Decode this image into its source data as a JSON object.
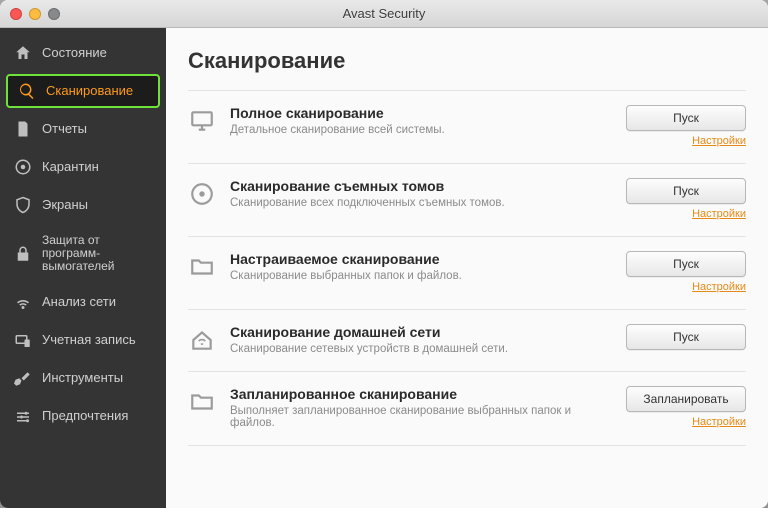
{
  "window": {
    "title": "Avast Security"
  },
  "sidebar": {
    "items": [
      {
        "label": "Состояние"
      },
      {
        "label": "Сканирование"
      },
      {
        "label": "Отчеты"
      },
      {
        "label": "Карантин"
      },
      {
        "label": "Экраны"
      },
      {
        "label": "Защита от программ-вымогателей"
      },
      {
        "label": "Анализ сети"
      },
      {
        "label": "Учетная запись"
      },
      {
        "label": "Инструменты"
      },
      {
        "label": "Предпочтения"
      }
    ]
  },
  "main": {
    "heading": "Сканирование",
    "settings_label": "Настройки",
    "scans": [
      {
        "title": "Полное сканирование",
        "desc": "Детальное сканирование всей системы.",
        "button": "Пуск",
        "settings": true
      },
      {
        "title": "Сканирование съемных томов",
        "desc": "Сканирование всех подключенных съемных томов.",
        "button": "Пуск",
        "settings": true
      },
      {
        "title": "Настраиваемое сканирование",
        "desc": "Сканирование выбранных папок и файлов.",
        "button": "Пуск",
        "settings": true
      },
      {
        "title": "Сканирование домашней сети",
        "desc": "Сканирование сетевых устройств в домашней сети.",
        "button": "Пуск",
        "settings": false
      },
      {
        "title": "Запланированное сканирование",
        "desc": "Выполняет запланированное сканирование выбранных папок и файлов.",
        "button": "Запланировать",
        "settings": true
      }
    ]
  }
}
